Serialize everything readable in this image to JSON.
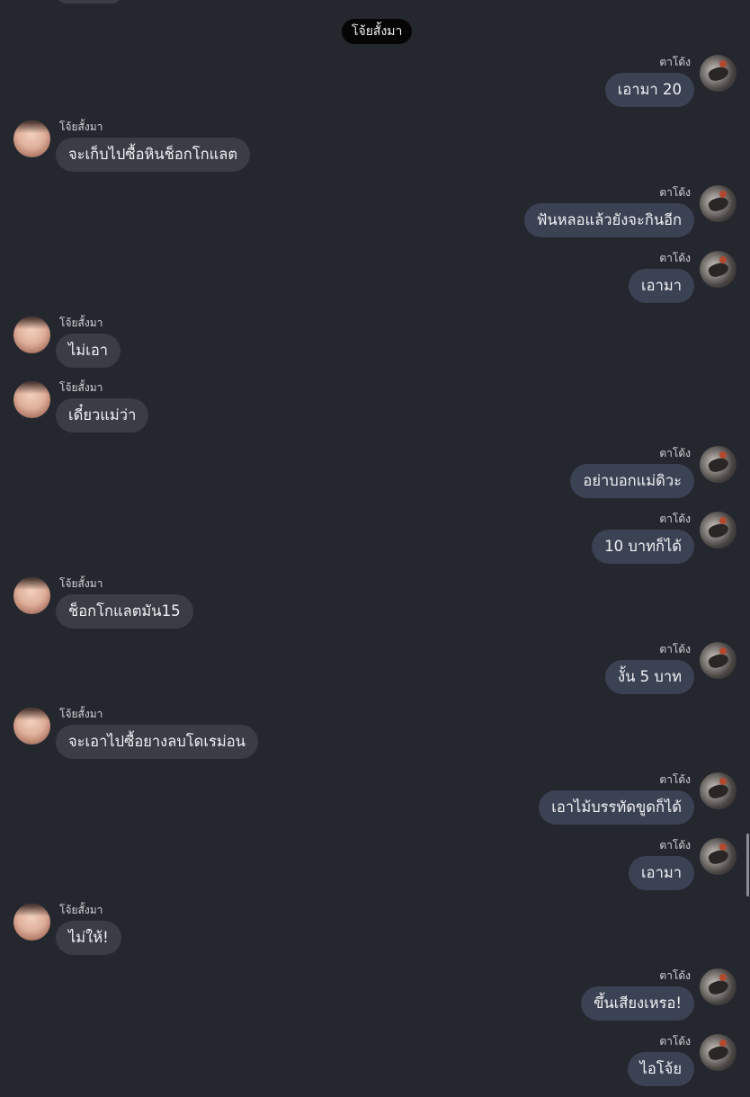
{
  "system_label": "โจ้ยสั้งมา",
  "messages": [
    {
      "side": "right",
      "sender": "ตาโด้ง",
      "text": "เอามา 20"
    },
    {
      "side": "left",
      "sender": "โจ้ยสั้งมา",
      "text": "จะเก็บไปซื้อหินช็อกโกแลต"
    },
    {
      "side": "right",
      "sender": "ตาโด้ง",
      "text": "ฟันหลอแล้วยังจะกินอีก"
    },
    {
      "side": "right",
      "sender": "ตาโด้ง",
      "text": "เอามา"
    },
    {
      "side": "left",
      "sender": "โจ้ยสั้งมา",
      "text": "ไม่เอา"
    },
    {
      "side": "left",
      "sender": "โจ้ยสั้งมา",
      "text": "เดี๋ยวแม่ว่า"
    },
    {
      "side": "right",
      "sender": "ตาโด้ง",
      "text": "อย่าบอกแม่ดิวะ"
    },
    {
      "side": "right",
      "sender": "ตาโด้ง",
      "text": "10 บาทก็ได้"
    },
    {
      "side": "left",
      "sender": "โจ้ยสั้งมา",
      "text": "ช็อกโกแลตมัน15"
    },
    {
      "side": "right",
      "sender": "ตาโด้ง",
      "text": "งั้น 5 บาท"
    },
    {
      "side": "left",
      "sender": "โจ้ยสั้งมา",
      "text": "จะเอาไปซื้อยางลบโดเรม่อน"
    },
    {
      "side": "right",
      "sender": "ตาโด้ง",
      "text": "เอาไม้บรรทัดขูดก็ได้"
    },
    {
      "side": "right",
      "sender": "ตาโด้ง",
      "text": "เอามา"
    },
    {
      "side": "left",
      "sender": "โจ้ยสั้งมา",
      "text": "ไม่ให้!"
    },
    {
      "side": "right",
      "sender": "ตาโด้ง",
      "text": "ขึ้นเสียงเหรอ!"
    },
    {
      "side": "right",
      "sender": "ตาโด้ง",
      "text": "ไอโจ้ย"
    }
  ]
}
